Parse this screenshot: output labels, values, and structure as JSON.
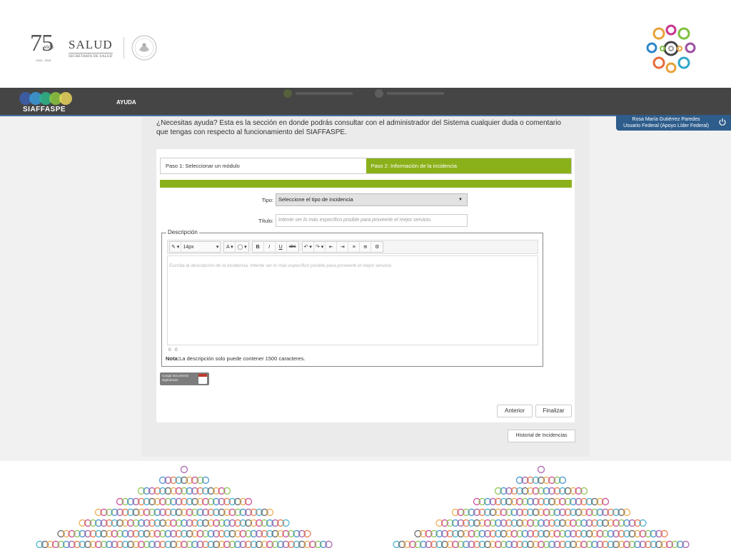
{
  "header": {
    "logo_75": {
      "number": "75",
      "anos": "AÑOS",
      "years": "1943 - 2018"
    },
    "logo_salud": {
      "word": "SALUD",
      "sub": "SECRETARÍA DE SALUD"
    }
  },
  "navbar": {
    "brand": "SIAFFASPE",
    "items": [
      {
        "label": "AYUDA"
      }
    ],
    "colors": {
      "bar": "#454545",
      "accent_line": "#4a6fa5"
    }
  },
  "user": {
    "name": "Rosa María Gutiérrez Paredes",
    "role": "Usuario Federal (Apoyo Líder Federal)",
    "icon": "power-icon"
  },
  "help": {
    "text": "¿Necesitas ayuda? Esta es la sección en donde podrás consultar con el administrador del Sistema cualquier duda o comentario que tengas con respecto al funcionamiento del SIAFFASPE."
  },
  "wizard": {
    "steps": [
      {
        "label": "Paso 1: Seleccionar un módulo",
        "active": false
      },
      {
        "label": "Paso 2: Información de la incidencia",
        "active": true
      }
    ],
    "accent_color": "#8bb11a"
  },
  "form": {
    "tipo_label": "Tipo:",
    "tipo_value": "Seleccione el tipo de incidencia",
    "titulo_label": "Título:",
    "titulo_placeholder": "Intente ser lo más específico posible para proveerle el mejor servicio.",
    "descripcion_legend": "Descripción",
    "font_size": "14px",
    "editor_placeholder": "Escriba la descripción de la incidencia. Intente ser lo más específico posible para proveerle el mejor servicio.",
    "counter_left": "0",
    "counter_right": "0",
    "nota_label": "Nota:",
    "nota_text": "La descripción solo puede contener 1500 caracteres.",
    "upload_label": "Cargar documento digitalizado"
  },
  "buttons": {
    "anterior": "Anterior",
    "finalizar": "Finalizar",
    "historial": "Historial de Incidencias"
  }
}
